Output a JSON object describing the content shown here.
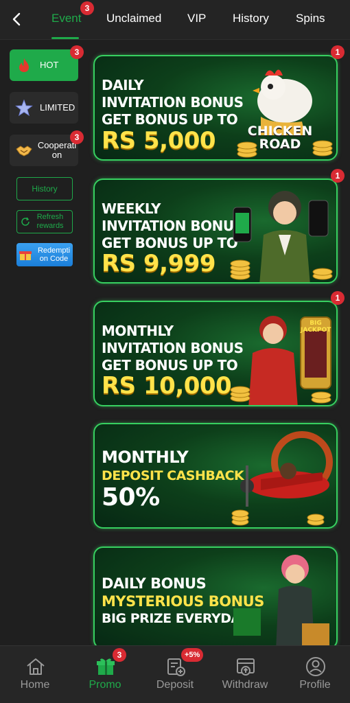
{
  "tabs": [
    {
      "label": "Event",
      "badge": "3"
    },
    {
      "label": "Unclaimed"
    },
    {
      "label": "VIP"
    },
    {
      "label": "History"
    },
    {
      "label": "Spins"
    }
  ],
  "sidebar": {
    "categories": [
      {
        "label": "HOT",
        "badge": "3"
      },
      {
        "label": "LIMITED"
      },
      {
        "label": "Cooperati on",
        "badge": "3"
      }
    ],
    "history_label": "History",
    "refresh_label": "Refresh rewards",
    "redeem_label": "Redempti on Code"
  },
  "banners": [
    {
      "badge": "1",
      "lines": [
        "DAILY",
        "INVITATION BONUS",
        "GET BONUS UP TO"
      ],
      "amount": "RS 5,000",
      "art_text": "CHICKEN ROAD"
    },
    {
      "badge": "1",
      "lines": [
        "WEEKLY",
        "INVITATION BONUS",
        "GET BONUS UP TO"
      ],
      "amount": "RS 9,999"
    },
    {
      "badge": "1",
      "lines": [
        "MONTHLY",
        "INVITATION BONUS",
        "GET BONUS UP TO"
      ],
      "amount": "RS 10,000",
      "art_text": "BIG JACKPOT"
    },
    {
      "lines": [
        "MONTHLY",
        "DEPOSIT CASHBACK"
      ],
      "amount": "50%"
    },
    {
      "lines": [
        "DAILY BONUS",
        "MYSTERIOUS BONUS",
        "BIG PRIZE EVERYDAY"
      ]
    }
  ],
  "bottom_nav": [
    {
      "label": "Home",
      "icon": "home-icon"
    },
    {
      "label": "Promo",
      "icon": "gift-icon",
      "badge": "3"
    },
    {
      "label": "Deposit",
      "icon": "deposit-icon",
      "badge": "+5%"
    },
    {
      "label": "Withdraw",
      "icon": "withdraw-icon"
    },
    {
      "label": "Profile",
      "icon": "profile-icon"
    }
  ],
  "colors": {
    "accent": "#1faa4a",
    "badge": "#d92b33",
    "banner_border": "#37d060",
    "highlight": "#ffe34a"
  }
}
